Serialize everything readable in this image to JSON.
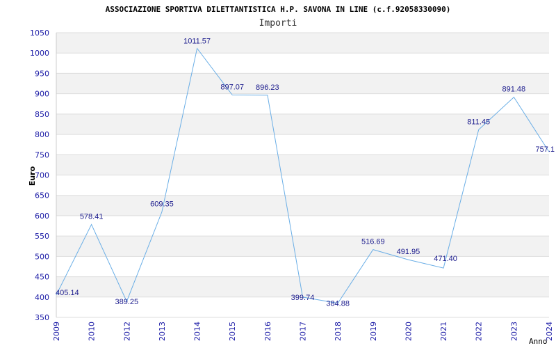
{
  "chart_data": {
    "type": "line",
    "title": "ASSOCIAZIONE SPORTIVA DILETTANTISTICA H.P. SAVONA IN LINE (c.f.92058330090)",
    "subtitle": "Importi",
    "xlabel": "Anno",
    "ylabel": "Euro",
    "ylim": [
      350,
      1050
    ],
    "ytick_step": 50,
    "yticks": [
      "350",
      "400",
      "450",
      "500",
      "550",
      "600",
      "650",
      "700",
      "750",
      "800",
      "850",
      "900",
      "950",
      "1000",
      "1050"
    ],
    "grid": true,
    "legend": "none",
    "categories": [
      "2009",
      "2010",
      "2012",
      "2013",
      "2014",
      "2015",
      "2016",
      "2017",
      "2018",
      "2019",
      "2020",
      "2021",
      "2022",
      "2023",
      "2024"
    ],
    "series": [
      {
        "values": [
          405.14,
          578.41,
          389.25,
          609.35,
          1011.57,
          897.07,
          896.23,
          399.74,
          384.88,
          516.69,
          491.95,
          471.4,
          811.45,
          891.48,
          757.1
        ],
        "labels": [
          "405.14",
          "578.41",
          "389.25",
          "609.35",
          "1011.57",
          "897.07",
          "896.23",
          "399.74",
          "384.88",
          "516.69",
          "491.95",
          "471.40",
          "811.45",
          "891.48",
          "757.1"
        ]
      }
    ]
  },
  "colors": {
    "line": "#6aaee6",
    "axis_text": "#1a1aa6",
    "label_text": "#1a1a8c",
    "band": "#f2f2f2",
    "grid": "#dddddd",
    "title": "#000000",
    "subtitle": "#333333"
  }
}
